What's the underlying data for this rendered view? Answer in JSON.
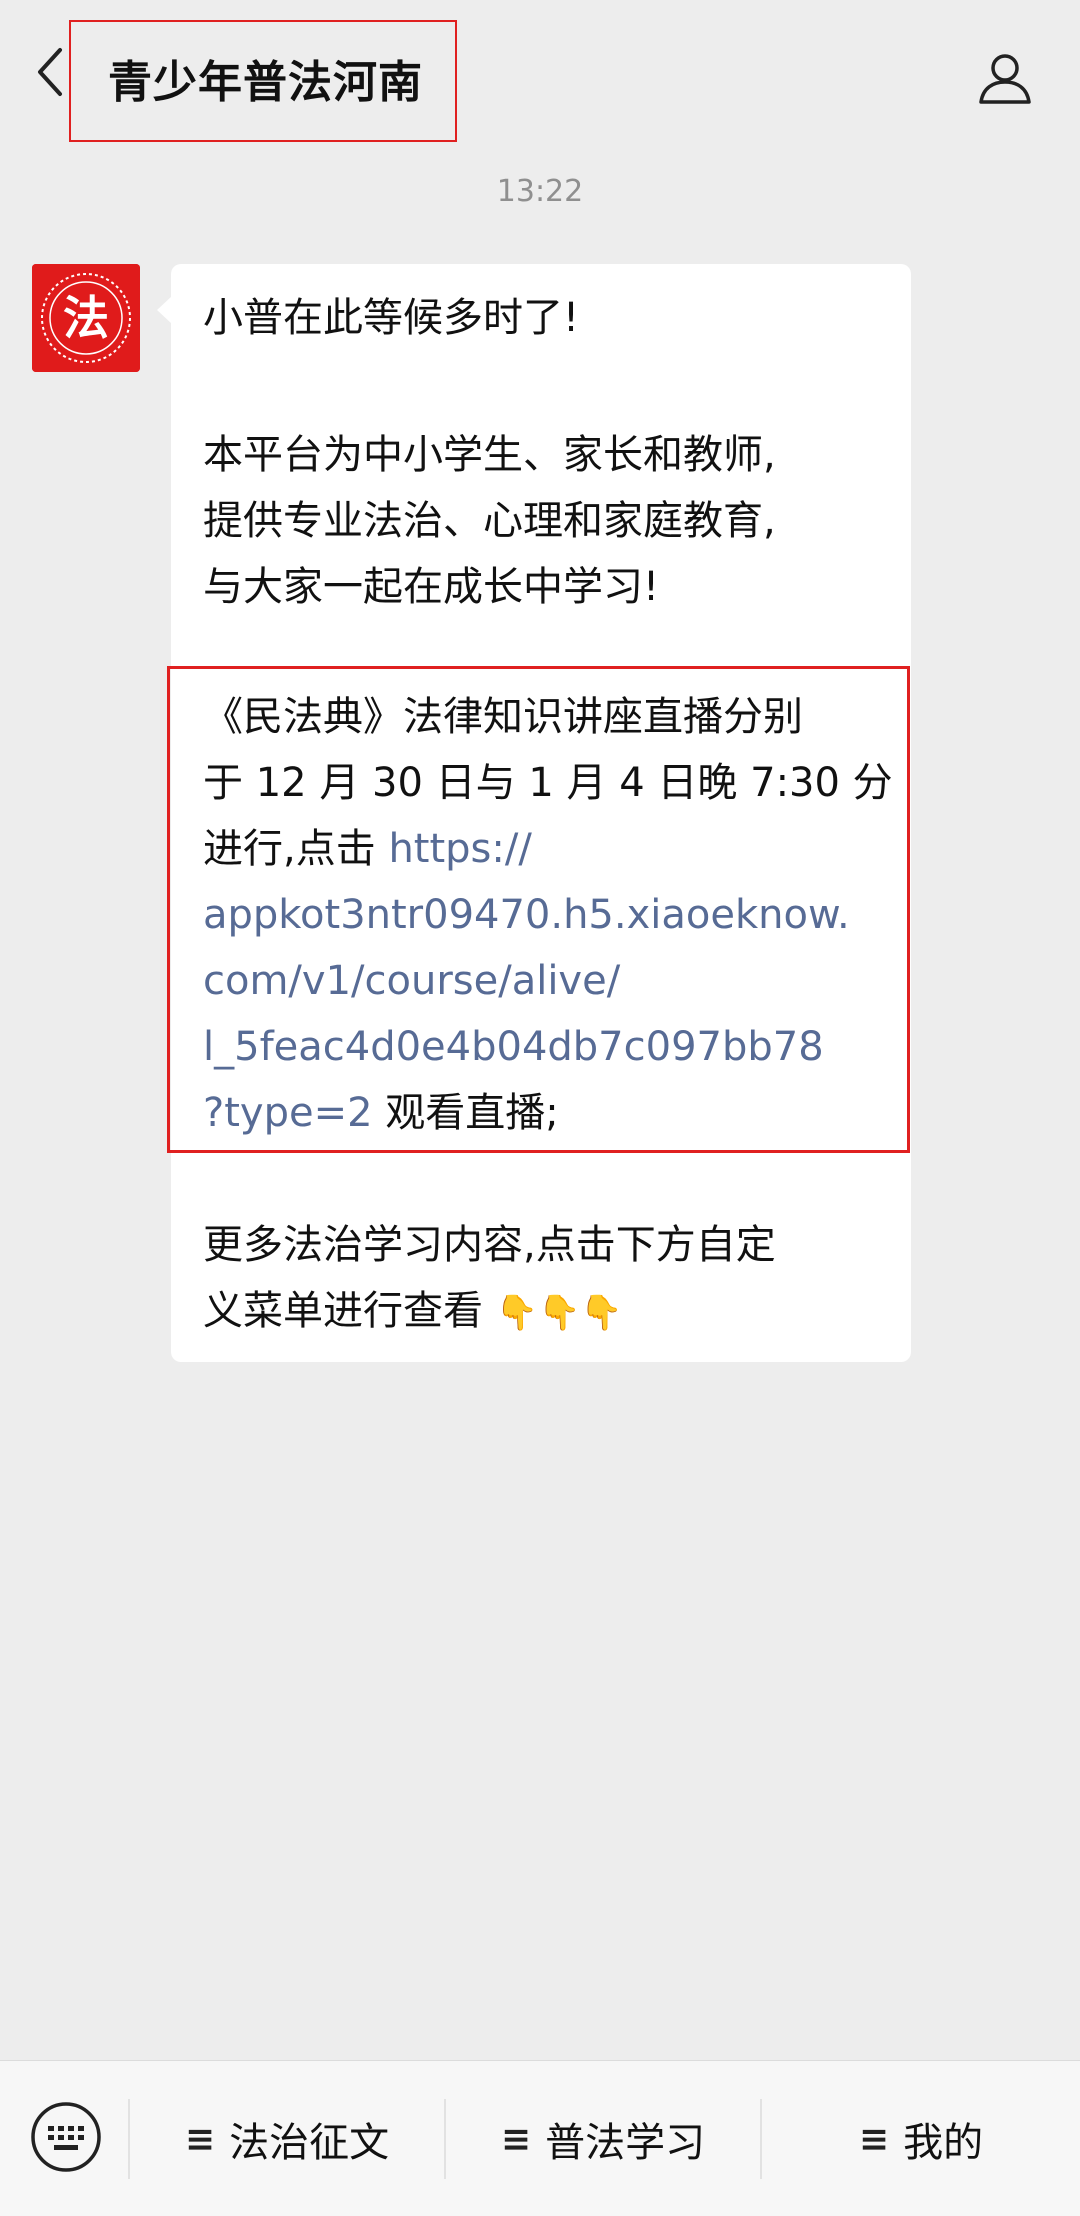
{
  "header": {
    "title": "青少年普法河南",
    "back_icon": "chevron-left-icon",
    "profile_icon": "person-icon"
  },
  "chat": {
    "timestamp": "13:22",
    "avatar": {
      "glyph": "法",
      "color": "#e01b1b"
    },
    "message": {
      "greeting": "小普在此等候多时了!",
      "intro_line1": " 本平台为中小学生、家长和教师,",
      "intro_line2": "提供专业法治、心理和家庭教育,",
      "intro_line3": "与大家一起在成长中学习!",
      "notice_line1": "《民法典》法律知识讲座直播分别",
      "notice_line2": "于 12 月 30 日与 1 月 4 日晚 7:30 分",
      "notice_line3_prefix": "进行,点击 ",
      "link_line1": "https://",
      "link_line2": "appkot3ntr09470.h5.xiaoeknow.",
      "link_line3": "com/v1/course/alive/",
      "link_line4": "l_5feac4d0e4b04db7c097bb78",
      "link_line5": "?type=2",
      "notice_suffix": " 观看直播;",
      "more_line1": "更多法治学习内容,点击下方自定",
      "more_line2": "义菜单进行查看",
      "emoji": "👇👇👇",
      "link_color": "#576b95"
    }
  },
  "menu": {
    "keyboard_icon": "keyboard-icon",
    "items": [
      {
        "label": "法治征文",
        "icon": "≡"
      },
      {
        "label": "普法学习",
        "icon": "≡"
      },
      {
        "label": "我的",
        "icon": "≡"
      }
    ]
  },
  "colors": {
    "background": "#ededed",
    "highlight_box": "#e02020",
    "bubble": "#ffffff"
  }
}
